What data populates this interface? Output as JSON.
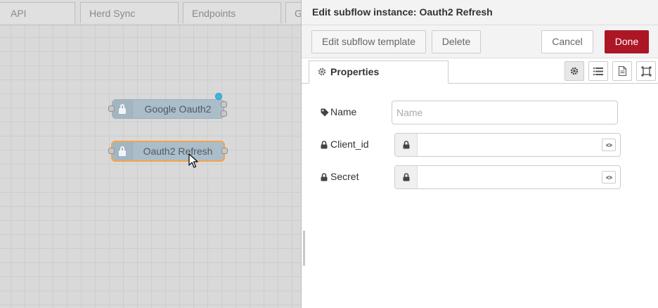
{
  "workspace": {
    "tabs": [
      {
        "label": "API"
      },
      {
        "label": "Herd Sync"
      },
      {
        "label": "Endpoints"
      },
      {
        "label": "G"
      }
    ],
    "nodes": [
      {
        "label": "Google Oauth2",
        "icon": "lock-icon"
      },
      {
        "label": "Oauth2 Refresh",
        "icon": "lock-icon"
      }
    ]
  },
  "tray": {
    "title": "Edit subflow instance: Oauth2 Refresh",
    "buttons": {
      "edit_template": "Edit subflow template",
      "delete": "Delete",
      "cancel": "Cancel",
      "done": "Done"
    },
    "tab": {
      "label": "Properties",
      "icon": "gear-icon"
    },
    "tab_icons": [
      "gear-icon",
      "list-icon",
      "document-icon",
      "frame-icon"
    ],
    "fields": {
      "name": {
        "label": "Name",
        "placeholder": "Name",
        "value": "",
        "icon": "tag-icon"
      },
      "client_id": {
        "label": "Client_id",
        "value": "",
        "icon": "lock-icon"
      },
      "secret": {
        "label": "Secret",
        "value": "",
        "icon": "lock-icon"
      }
    }
  },
  "colors": {
    "primary": "#ad1625",
    "selected_border": "#f5a34a",
    "status_dot": "#3eb6e6",
    "node_fill": "#aabdc9"
  }
}
